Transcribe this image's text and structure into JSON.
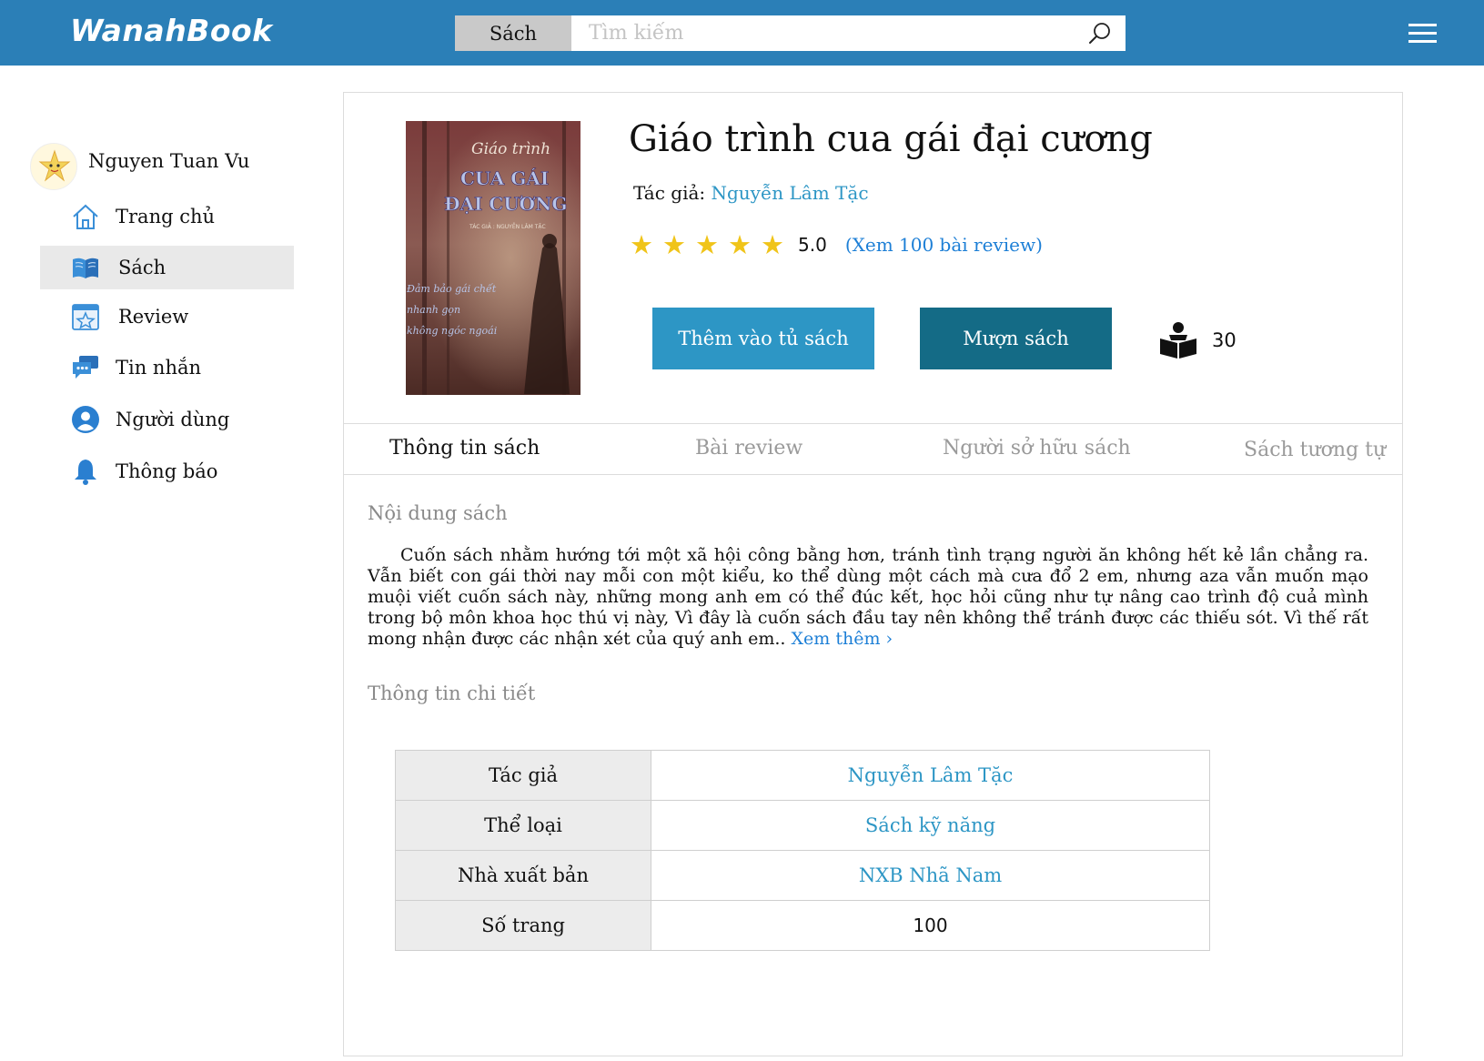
{
  "app": {
    "logo": "WanahBook",
    "accent": "#2b7fb7"
  },
  "search": {
    "category": "Sách",
    "placeholder": "Tìm kiếm"
  },
  "user": {
    "name": "Nguyen Tuan Vu"
  },
  "sidebar": {
    "items": [
      {
        "label": "Trang chủ",
        "icon": "home-icon",
        "active": false
      },
      {
        "label": "Sách",
        "icon": "book-icon",
        "active": true
      },
      {
        "label": "Review",
        "icon": "review-star-icon",
        "active": false
      },
      {
        "label": "Tin nhắn",
        "icon": "chat-icon",
        "active": false
      },
      {
        "label": "Người dùng",
        "icon": "user-icon",
        "active": false
      },
      {
        "label": "Thông báo",
        "icon": "bell-icon",
        "active": false
      }
    ]
  },
  "book": {
    "title": "Giáo trình cua gái đại cương",
    "author_label": "Tác giả:",
    "author": "Nguyễn Lâm Tặc",
    "rating": "5.0",
    "stars": 5,
    "review_link": "(Xem 100 bài review)",
    "add_button": "Thêm vào tủ sách",
    "borrow_button": "Mượn sách",
    "borrow_count": "30",
    "cover": {
      "line1": "Giáo trình",
      "line2": "CUA GÁI",
      "line3": "ĐẠI CƯƠNG",
      "byline": "TÁC GIẢ : NGUYỄN LÂM TẶC",
      "tag1": "Đảm bảo gái chết",
      "tag2": "nhanh gọn",
      "tag3": "không ngóc ngoái"
    }
  },
  "tabs": [
    {
      "label": "Thông tin sách",
      "active": true
    },
    {
      "label": "Bài review",
      "active": false
    },
    {
      "label": "Người sở hữu sách",
      "active": false
    },
    {
      "label": "Sách tương tự",
      "active": false
    }
  ],
  "content": {
    "summary_title": "Nội dung sách",
    "summary": "Cuốn sách nhằm hướng tới một xã hội công bằng hơn, tránh tình trạng người ăn không hết kẻ lần chẳng ra. Vẫn biết con gái thời nay mỗi con một kiểu, ko thể dùng một cách mà cưa đổ 2 em, nhưng aza vẫn muốn mạo muội viết cuốn sách này, những mong anh em có thể đúc kết, học hỏi cũng như tự nâng cao trình độ cuả mình trong bộ môn khoa học thú vị này, Vì đây là cuốn sách đầu tay nên không thể tránh được các thiếu sót. Vì thế rất mong nhận được các nhận xét của quý anh em..",
    "more": "Xem thêm ›",
    "details_title": "Thông tin chi tiết",
    "details": [
      {
        "key": "Tác giả",
        "value": "Nguyễn Lâm Tặc"
      },
      {
        "key": "Thể loại",
        "value": "Sách kỹ năng"
      },
      {
        "key": "Nhà xuất bản",
        "value": "NXB Nhã Nam"
      },
      {
        "key": "Số trang",
        "value": "100"
      }
    ]
  }
}
